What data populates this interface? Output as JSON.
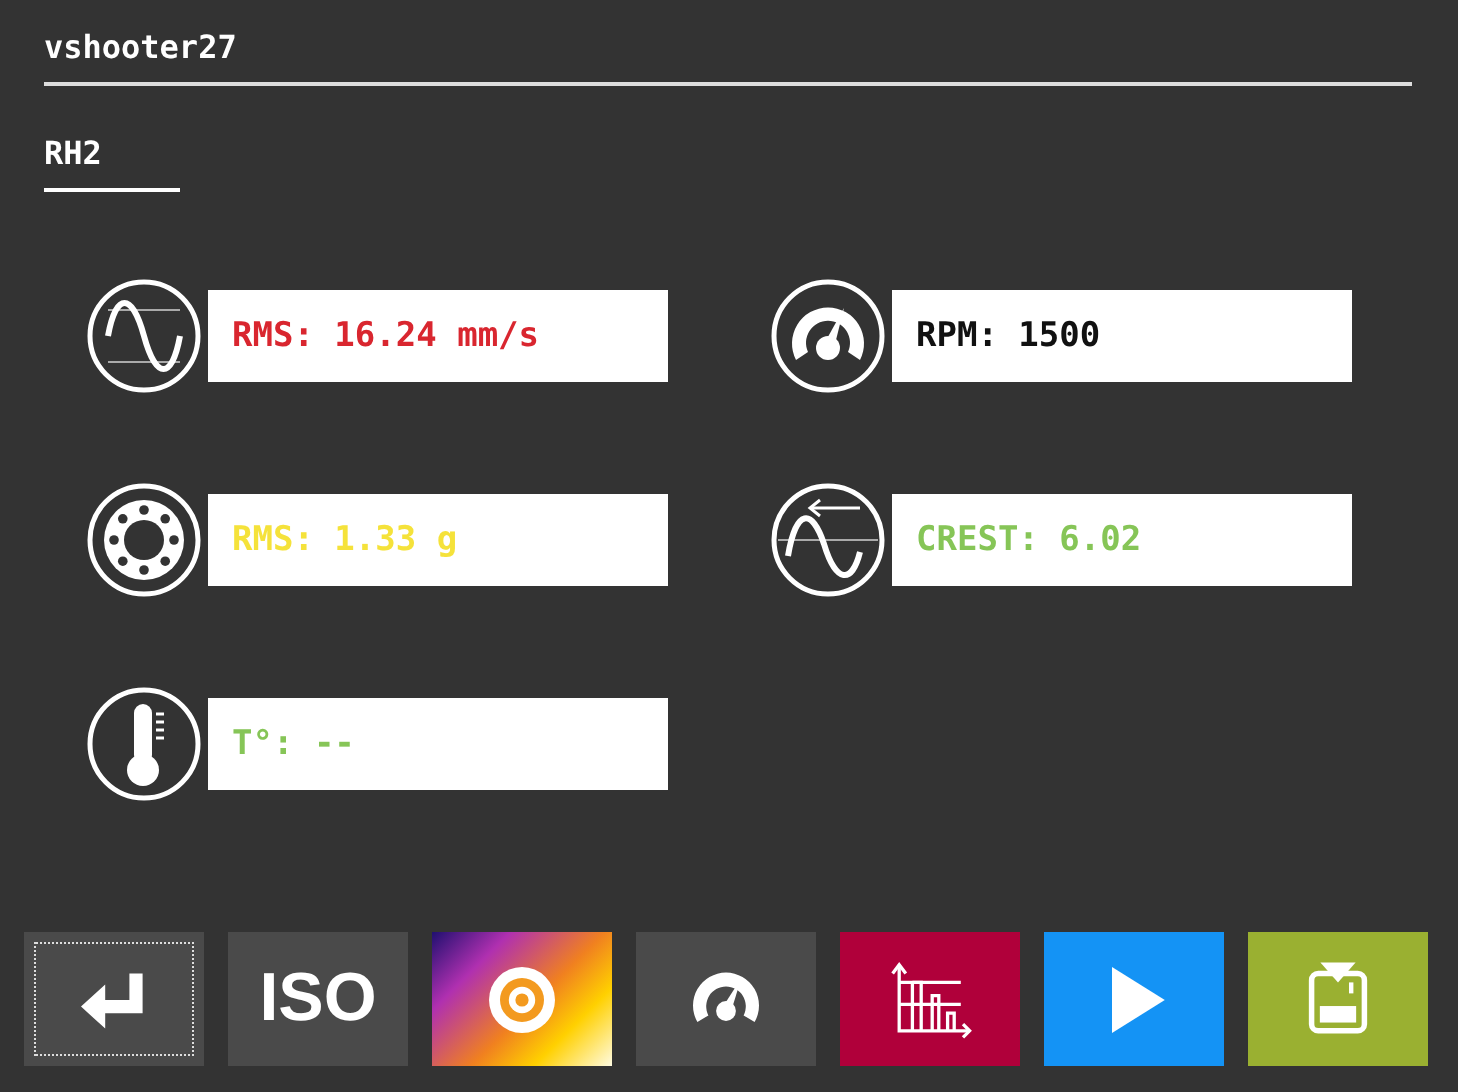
{
  "header": {
    "title": "vshooter27"
  },
  "channel": {
    "label": "RH2"
  },
  "readings": [
    {
      "kind": "velocity",
      "text": "RMS: 16.24 mm/s",
      "color": "#d9262f"
    },
    {
      "kind": "rpm",
      "text": "RPM: 1500",
      "color": "#111111"
    },
    {
      "kind": "bearing",
      "text": "RMS: 1.33 g",
      "color": "#f5e23a"
    },
    {
      "kind": "crest",
      "text": "CREST: 6.02",
      "color": "#86c557"
    },
    {
      "kind": "temperature",
      "text": "T°: --",
      "color": "#86c557"
    }
  ],
  "toolbar": [
    {
      "kind": "enter",
      "focused": true
    },
    {
      "kind": "iso",
      "label": "ISO",
      "focused": false
    },
    {
      "kind": "thermal",
      "focused": false
    },
    {
      "kind": "speed",
      "focused": false
    },
    {
      "kind": "spectrum",
      "focused": false
    },
    {
      "kind": "play",
      "focused": false
    },
    {
      "kind": "save",
      "focused": false
    }
  ]
}
